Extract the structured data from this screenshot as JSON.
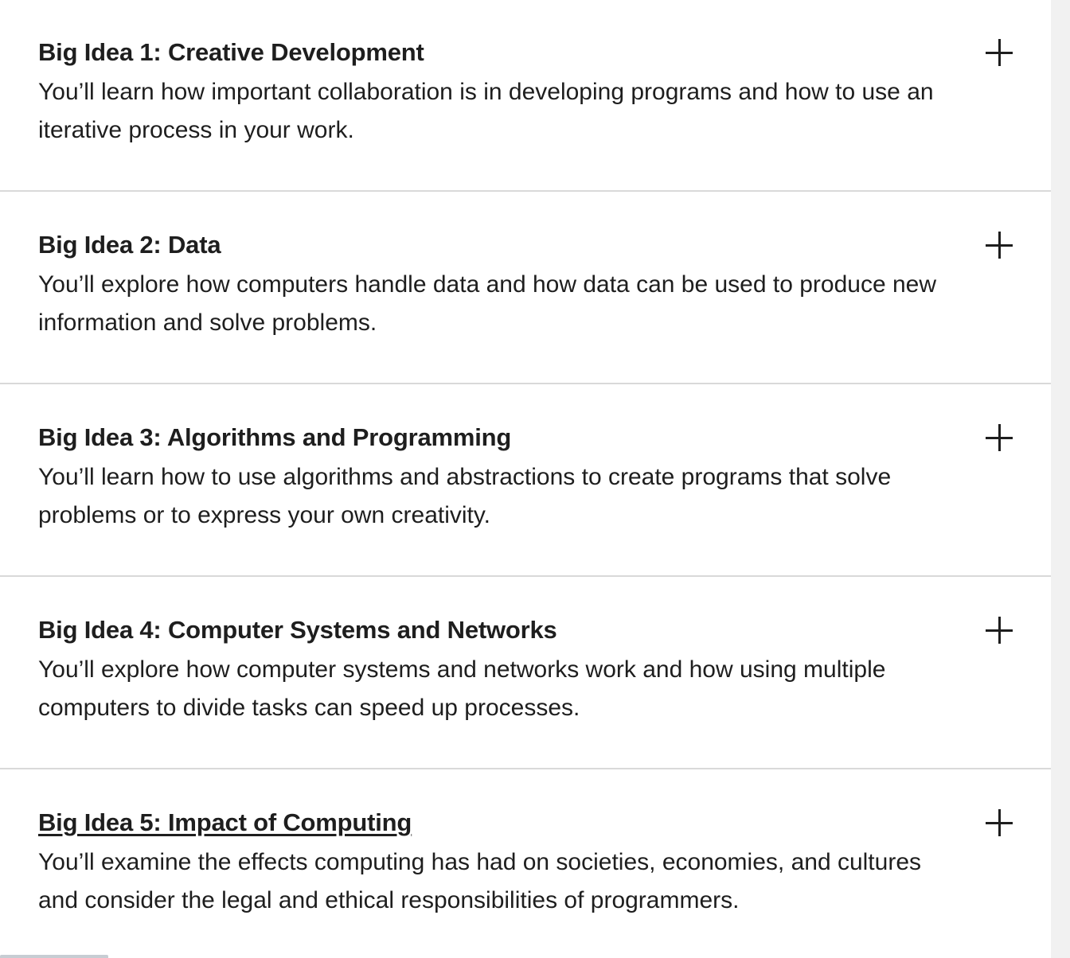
{
  "accordion": {
    "items": [
      {
        "title": "Big Idea 1: Creative Development",
        "description": "You’ll learn how important collaboration is in developing programs and how to use an iterative process in your work."
      },
      {
        "title": "Big Idea 2: Data",
        "description": "You’ll explore how computers handle data and how data can be used to produce new information and solve problems."
      },
      {
        "title": "Big Idea 3: Algorithms and Programming",
        "description": "You’ll learn how to use algorithms and abstractions to create programs that solve problems or to express your own creativity."
      },
      {
        "title": "Big Idea 4: Computer Systems and Networks",
        "description": "You’ll explore how computer systems and networks work and how using multiple computers to divide tasks can speed up processes."
      },
      {
        "title": "Big Idea 5: Impact of Computing",
        "description": "You’ll examine the effects computing has had on societies, economies, and cultures and consider the legal and ethical responsibilities of programmers."
      }
    ],
    "expand_icon": "plus-icon"
  }
}
